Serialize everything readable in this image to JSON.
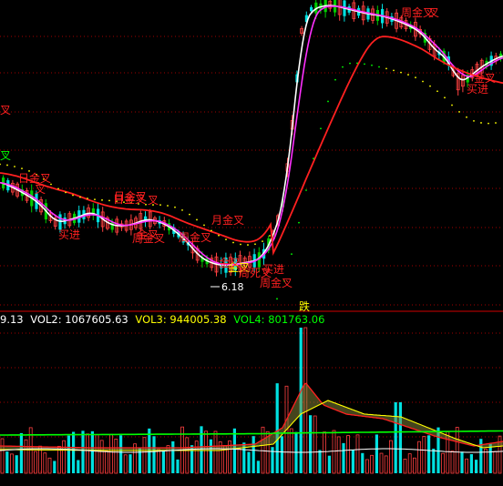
{
  "colors": {
    "background": "#000000",
    "grid": "#a00000",
    "divider": "#d00000",
    "up": "#ff4040",
    "down": "#00e0e0",
    "ma_white": "#ffffff",
    "ma_magenta": "#ff30ff",
    "ma_red": "#ff2020",
    "ma_green": "#00ff00",
    "ma_yellow": "#ffff00",
    "label_red": "#ff2020",
    "label_yellow": "#ffff00",
    "label_white": "#ffffff",
    "vol1": "#ffffff",
    "vol2": "#ffffff",
    "vol3": "#ffff00",
    "vol4": "#00ff00"
  },
  "price_panel": {
    "low_marker": "6.18",
    "cursor_label": "跌",
    "signals": [
      {
        "text": "叉",
        "color": "label_red"
      },
      {
        "text": "叉",
        "color": "label_green"
      },
      {
        "text": "日金叉",
        "color": "label_red"
      },
      {
        "text": "叉",
        "color": "label_red"
      },
      {
        "text": "买进",
        "color": "label_red"
      },
      {
        "text": "日金叉",
        "color": "label_red"
      },
      {
        "text": "金叉",
        "color": "label_red"
      },
      {
        "text": "周金叉",
        "color": "label_red"
      },
      {
        "text": "月金叉",
        "color": "label_red"
      },
      {
        "text": "叉",
        "color": "label_red"
      },
      {
        "text": "周金叉",
        "color": "label_red"
      },
      {
        "text": "金叉",
        "color": "label_yellow"
      },
      {
        "text": "周死叉",
        "color": "label_red"
      },
      {
        "text": "买进",
        "color": "label_red"
      },
      {
        "text": "周金叉",
        "color": "label_red"
      },
      {
        "text": "金叉",
        "color": "label_red"
      },
      {
        "text": "日金叉",
        "color": "label_red"
      },
      {
        "text": "周金叉",
        "color": "label_red"
      },
      {
        "text": "叉",
        "color": "label_red"
      },
      {
        "text": "金叉",
        "color": "label_red"
      },
      {
        "text": "买进",
        "color": "label_red"
      }
    ]
  },
  "volume_panel": {
    "legend": [
      {
        "text": "9.13",
        "color": "vol1"
      },
      {
        "text": "VOL2: 1067605.63",
        "color": "vol2"
      },
      {
        "text": "VOL3: 944005.38",
        "color": "vol3"
      },
      {
        "text": "VOL4: 801763.06",
        "color": "vol4"
      }
    ]
  }
}
